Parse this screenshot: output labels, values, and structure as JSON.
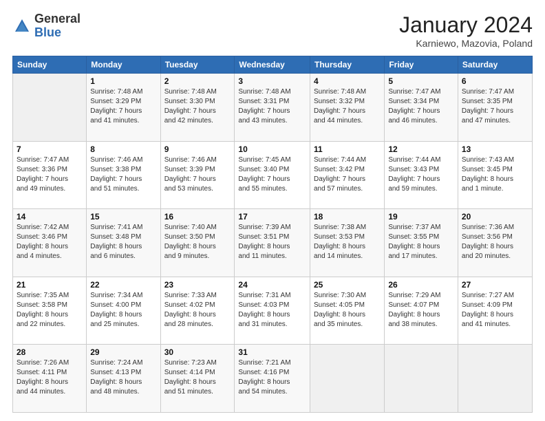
{
  "header": {
    "logo_general": "General",
    "logo_blue": "Blue",
    "month_title": "January 2024",
    "location": "Karniewo, Mazovia, Poland"
  },
  "days_of_week": [
    "Sunday",
    "Monday",
    "Tuesday",
    "Wednesday",
    "Thursday",
    "Friday",
    "Saturday"
  ],
  "weeks": [
    [
      {
        "num": "",
        "info": ""
      },
      {
        "num": "1",
        "info": "Sunrise: 7:48 AM\nSunset: 3:29 PM\nDaylight: 7 hours\nand 41 minutes."
      },
      {
        "num": "2",
        "info": "Sunrise: 7:48 AM\nSunset: 3:30 PM\nDaylight: 7 hours\nand 42 minutes."
      },
      {
        "num": "3",
        "info": "Sunrise: 7:48 AM\nSunset: 3:31 PM\nDaylight: 7 hours\nand 43 minutes."
      },
      {
        "num": "4",
        "info": "Sunrise: 7:48 AM\nSunset: 3:32 PM\nDaylight: 7 hours\nand 44 minutes."
      },
      {
        "num": "5",
        "info": "Sunrise: 7:47 AM\nSunset: 3:34 PM\nDaylight: 7 hours\nand 46 minutes."
      },
      {
        "num": "6",
        "info": "Sunrise: 7:47 AM\nSunset: 3:35 PM\nDaylight: 7 hours\nand 47 minutes."
      }
    ],
    [
      {
        "num": "7",
        "info": "Sunrise: 7:47 AM\nSunset: 3:36 PM\nDaylight: 7 hours\nand 49 minutes."
      },
      {
        "num": "8",
        "info": "Sunrise: 7:46 AM\nSunset: 3:38 PM\nDaylight: 7 hours\nand 51 minutes."
      },
      {
        "num": "9",
        "info": "Sunrise: 7:46 AM\nSunset: 3:39 PM\nDaylight: 7 hours\nand 53 minutes."
      },
      {
        "num": "10",
        "info": "Sunrise: 7:45 AM\nSunset: 3:40 PM\nDaylight: 7 hours\nand 55 minutes."
      },
      {
        "num": "11",
        "info": "Sunrise: 7:44 AM\nSunset: 3:42 PM\nDaylight: 7 hours\nand 57 minutes."
      },
      {
        "num": "12",
        "info": "Sunrise: 7:44 AM\nSunset: 3:43 PM\nDaylight: 7 hours\nand 59 minutes."
      },
      {
        "num": "13",
        "info": "Sunrise: 7:43 AM\nSunset: 3:45 PM\nDaylight: 8 hours\nand 1 minute."
      }
    ],
    [
      {
        "num": "14",
        "info": "Sunrise: 7:42 AM\nSunset: 3:46 PM\nDaylight: 8 hours\nand 4 minutes."
      },
      {
        "num": "15",
        "info": "Sunrise: 7:41 AM\nSunset: 3:48 PM\nDaylight: 8 hours\nand 6 minutes."
      },
      {
        "num": "16",
        "info": "Sunrise: 7:40 AM\nSunset: 3:50 PM\nDaylight: 8 hours\nand 9 minutes."
      },
      {
        "num": "17",
        "info": "Sunrise: 7:39 AM\nSunset: 3:51 PM\nDaylight: 8 hours\nand 11 minutes."
      },
      {
        "num": "18",
        "info": "Sunrise: 7:38 AM\nSunset: 3:53 PM\nDaylight: 8 hours\nand 14 minutes."
      },
      {
        "num": "19",
        "info": "Sunrise: 7:37 AM\nSunset: 3:55 PM\nDaylight: 8 hours\nand 17 minutes."
      },
      {
        "num": "20",
        "info": "Sunrise: 7:36 AM\nSunset: 3:56 PM\nDaylight: 8 hours\nand 20 minutes."
      }
    ],
    [
      {
        "num": "21",
        "info": "Sunrise: 7:35 AM\nSunset: 3:58 PM\nDaylight: 8 hours\nand 22 minutes."
      },
      {
        "num": "22",
        "info": "Sunrise: 7:34 AM\nSunset: 4:00 PM\nDaylight: 8 hours\nand 25 minutes."
      },
      {
        "num": "23",
        "info": "Sunrise: 7:33 AM\nSunset: 4:02 PM\nDaylight: 8 hours\nand 28 minutes."
      },
      {
        "num": "24",
        "info": "Sunrise: 7:31 AM\nSunset: 4:03 PM\nDaylight: 8 hours\nand 31 minutes."
      },
      {
        "num": "25",
        "info": "Sunrise: 7:30 AM\nSunset: 4:05 PM\nDaylight: 8 hours\nand 35 minutes."
      },
      {
        "num": "26",
        "info": "Sunrise: 7:29 AM\nSunset: 4:07 PM\nDaylight: 8 hours\nand 38 minutes."
      },
      {
        "num": "27",
        "info": "Sunrise: 7:27 AM\nSunset: 4:09 PM\nDaylight: 8 hours\nand 41 minutes."
      }
    ],
    [
      {
        "num": "28",
        "info": "Sunrise: 7:26 AM\nSunset: 4:11 PM\nDaylight: 8 hours\nand 44 minutes."
      },
      {
        "num": "29",
        "info": "Sunrise: 7:24 AM\nSunset: 4:13 PM\nDaylight: 8 hours\nand 48 minutes."
      },
      {
        "num": "30",
        "info": "Sunrise: 7:23 AM\nSunset: 4:14 PM\nDaylight: 8 hours\nand 51 minutes."
      },
      {
        "num": "31",
        "info": "Sunrise: 7:21 AM\nSunset: 4:16 PM\nDaylight: 8 hours\nand 54 minutes."
      },
      {
        "num": "",
        "info": ""
      },
      {
        "num": "",
        "info": ""
      },
      {
        "num": "",
        "info": ""
      }
    ]
  ]
}
